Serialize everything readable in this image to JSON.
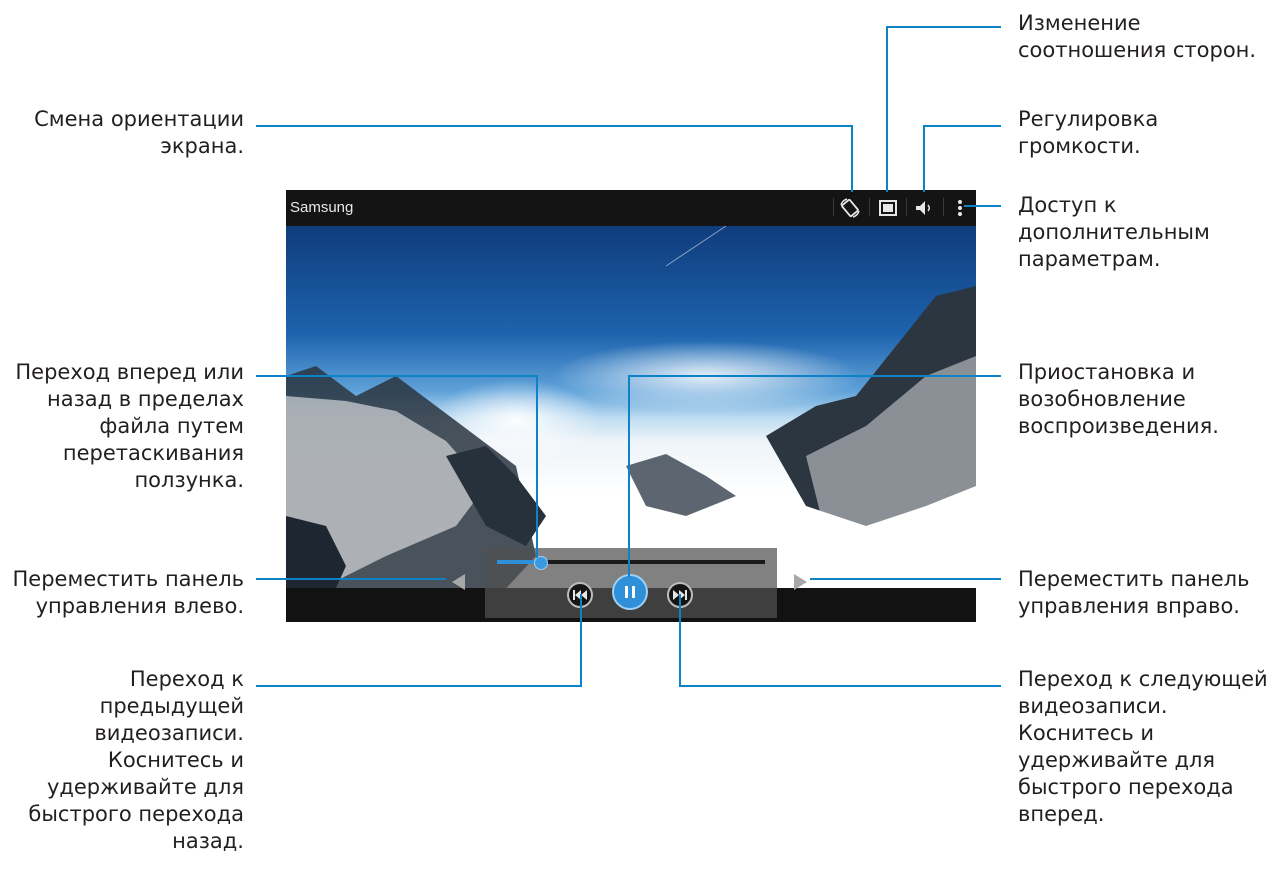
{
  "player": {
    "title": "Samsung",
    "progress_fraction": 0.16,
    "colors": {
      "accent": "#2f8fd8",
      "callout_line": "#0e82c6"
    },
    "icons": [
      "rotate-screen-icon",
      "aspect-ratio-icon",
      "volume-icon",
      "more-options-icon",
      "rewind-icon",
      "pause-icon",
      "fast-forward-icon",
      "move-left-arrow-icon",
      "move-right-arrow-icon"
    ]
  },
  "callouts": {
    "rotate": "Смена ориентации\nэкрана.",
    "seek": "Переход вперед или\nназад в пределах\nфайла путем\nперетаскивания\nползунка.",
    "move_left": "Переместить панель\nуправления влево.",
    "previous": "Переход к\nпредыдущей\nвидеозаписи.\nКоснитесь и\nудерживайте для\nбыстрого перехода\nназад.",
    "aspect": "Изменение\nсоотношения сторон.",
    "volume": "Регулировка\nгромкости.",
    "more": "Доступ к\nдополнительным\nпараметрам.",
    "pause": "Приостановка и\nвозобновление\nвоспроизведения.",
    "move_right": "Переместить панель\nуправления вправо.",
    "next": "Переход к следующей\nвидеозаписи.\nКоснитесь и\nудерживайте для\nбыстрого перехода\nвперед."
  }
}
